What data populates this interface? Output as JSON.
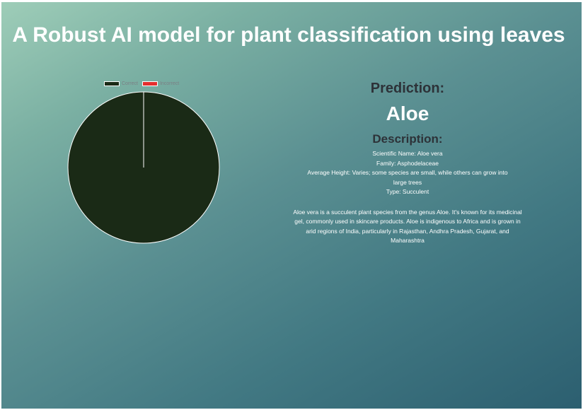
{
  "header": {
    "title": "A Robust AI model for plant classification using leaves"
  },
  "chart_data": {
    "type": "pie",
    "categories": [
      "Correct",
      "Incorrect"
    ],
    "values": [
      100,
      0
    ],
    "colors": [
      "#1a2a16",
      "#e32e2e"
    ],
    "legend_position": "top"
  },
  "prediction": {
    "heading": "Prediction:",
    "value": "Aloe"
  },
  "description": {
    "heading": "Description:",
    "scientific_name": "Scientific Name: Aloe vera",
    "family": "Family: Asphodelaceae",
    "average_height": "Average Height: Varies; some species are small, while others can grow into large trees",
    "type": "Type: Succulent",
    "summary": "Aloe vera is a succulent plant species from the genus Aloe. It's known for its medicinal gel, commonly used in skincare products. Aloe is indigenous to Africa and is grown in arid regions of India, particularly in Rajasthan, Andhra Pradesh, Gujarat, and Maharashtra"
  }
}
